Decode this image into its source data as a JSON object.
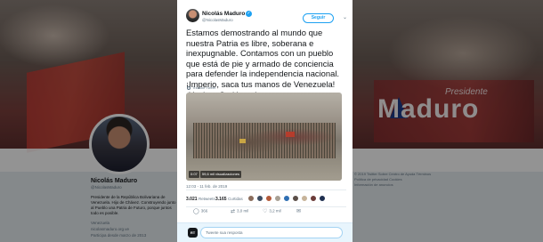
{
  "banner": {
    "brand_small": "Presidente",
    "brand_big": "Maduro"
  },
  "profile": {
    "name": "Nicolás Maduro",
    "handle": "@NicolasMaduro",
    "bio": "Presidente de la República Bolivariana de Venezuela. Hijo de Chávez. Construyendo junto al Pueblo una Patria de Futuro, porque juntos todo es posible.",
    "location": "Venezuela",
    "website": "nicolasmaduro.org.ve",
    "joined": "Participa desde marzo de 2013"
  },
  "footer": {
    "lines": [
      "© 2019 Twitter   Sobre   Centro de Ayuda   Términos",
      "Política de privacidad   Cookies",
      "Información de anuncios"
    ]
  },
  "tweet": {
    "author_name": "Nicolás Maduro",
    "author_handle": "@NicolasMaduro",
    "follow_label": "Seguir",
    "text": "Estamos demostrando al mundo que nuestra Patria es libre, soberana e inexpugnable. Contamos con un pueblo que está de pie y armado de conciencia para defender la independencia nacional. ¡Imperio, saca tus manos de Venezuela! ¡Yankee Go Home!",
    "translate_label": "Traducir Tweet",
    "video_time": "0:07",
    "video_views": "59,6 mil visualizaciones",
    "timestamp": "12:03 - 11 feb. de 2019",
    "retweets_count": "3.021",
    "retweets_label": "Retweets",
    "likes_count": "3.165",
    "likes_label": "Curtidas",
    "reply_count": "366",
    "retweet_action_count": "3,0 mil",
    "like_action_count": "3,2 mil",
    "reply_avatar_text": "RT",
    "reply_placeholder": "Tweete sua resposta"
  },
  "colors": {
    "accent": "#1da1f2",
    "modal_bg": "#ffffff",
    "overlay": "rgba(0,0,0,0.42)"
  },
  "icons": [
    "verified-badge-icon",
    "chevron-down-icon",
    "globe-icon",
    "reply-icon",
    "retweet-icon",
    "heart-icon",
    "envelope-icon"
  ]
}
